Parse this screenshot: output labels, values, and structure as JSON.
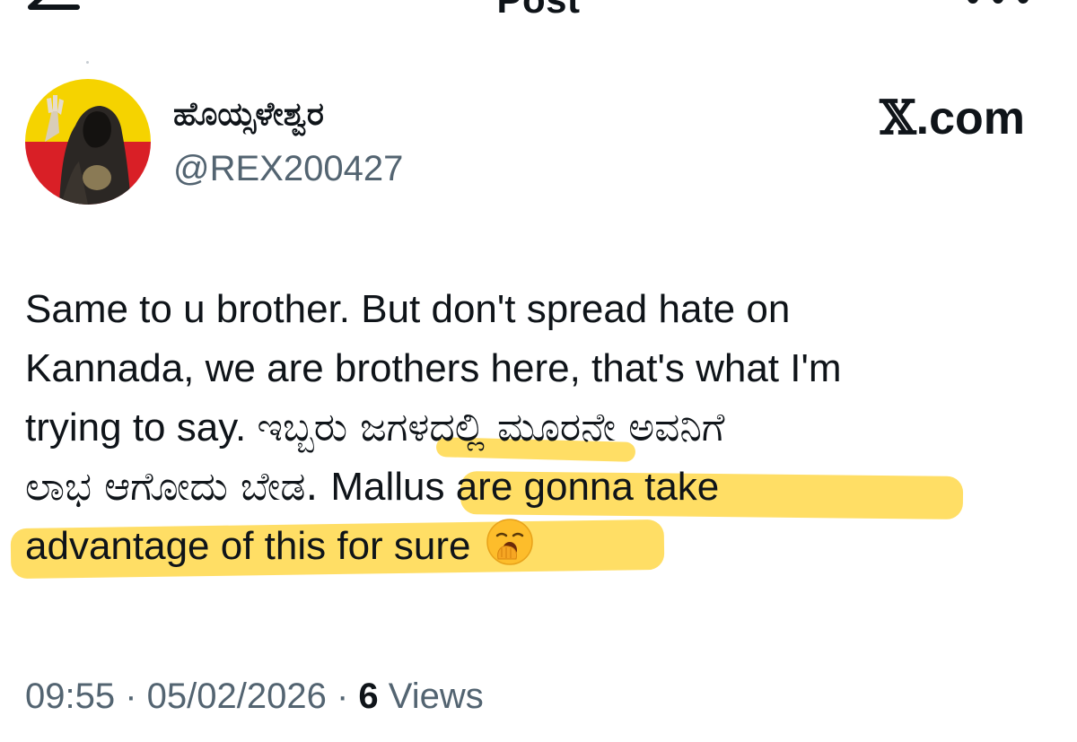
{
  "header": {
    "title": "Post",
    "back_icon": "arrow-left-icon",
    "more_icon": "more-horizontal-icon"
  },
  "author": {
    "display_name": "ಹೊಯ್ಸಳೇಶ್ವರ",
    "handle": "@REX200427",
    "avatar_colors": {
      "top": "#f5d300",
      "bottom": "#d91f26"
    }
  },
  "watermark": {
    "logo": "𝕏",
    "suffix": ".com"
  },
  "tweet": {
    "line1": "Same to u brother. But don't spread hate on",
    "line2": "Kannada, we are brothers here, that's what I'm",
    "line3_en": "trying to say. ",
    "line3_kn": "ಇಬ್ಬರು ಜಗಳದಲ್ಲಿ ಮೂರನೇ ಅವನಿಗೆ",
    "line4_kn": "ಲಾಭ ಆಗೋದು ಬೇಡ. ",
    "line4_hl": "Mallus are gonna take",
    "line5_hl": "advantage of this for sure",
    "emoji": "yawning-face-emoji",
    "highlight_color": "#ffd84a"
  },
  "meta": {
    "time": "09:55",
    "sep1": " · ",
    "date": "05/02/2026",
    "sep2": " · ",
    "views_count": "6",
    "views_label": " Views"
  }
}
